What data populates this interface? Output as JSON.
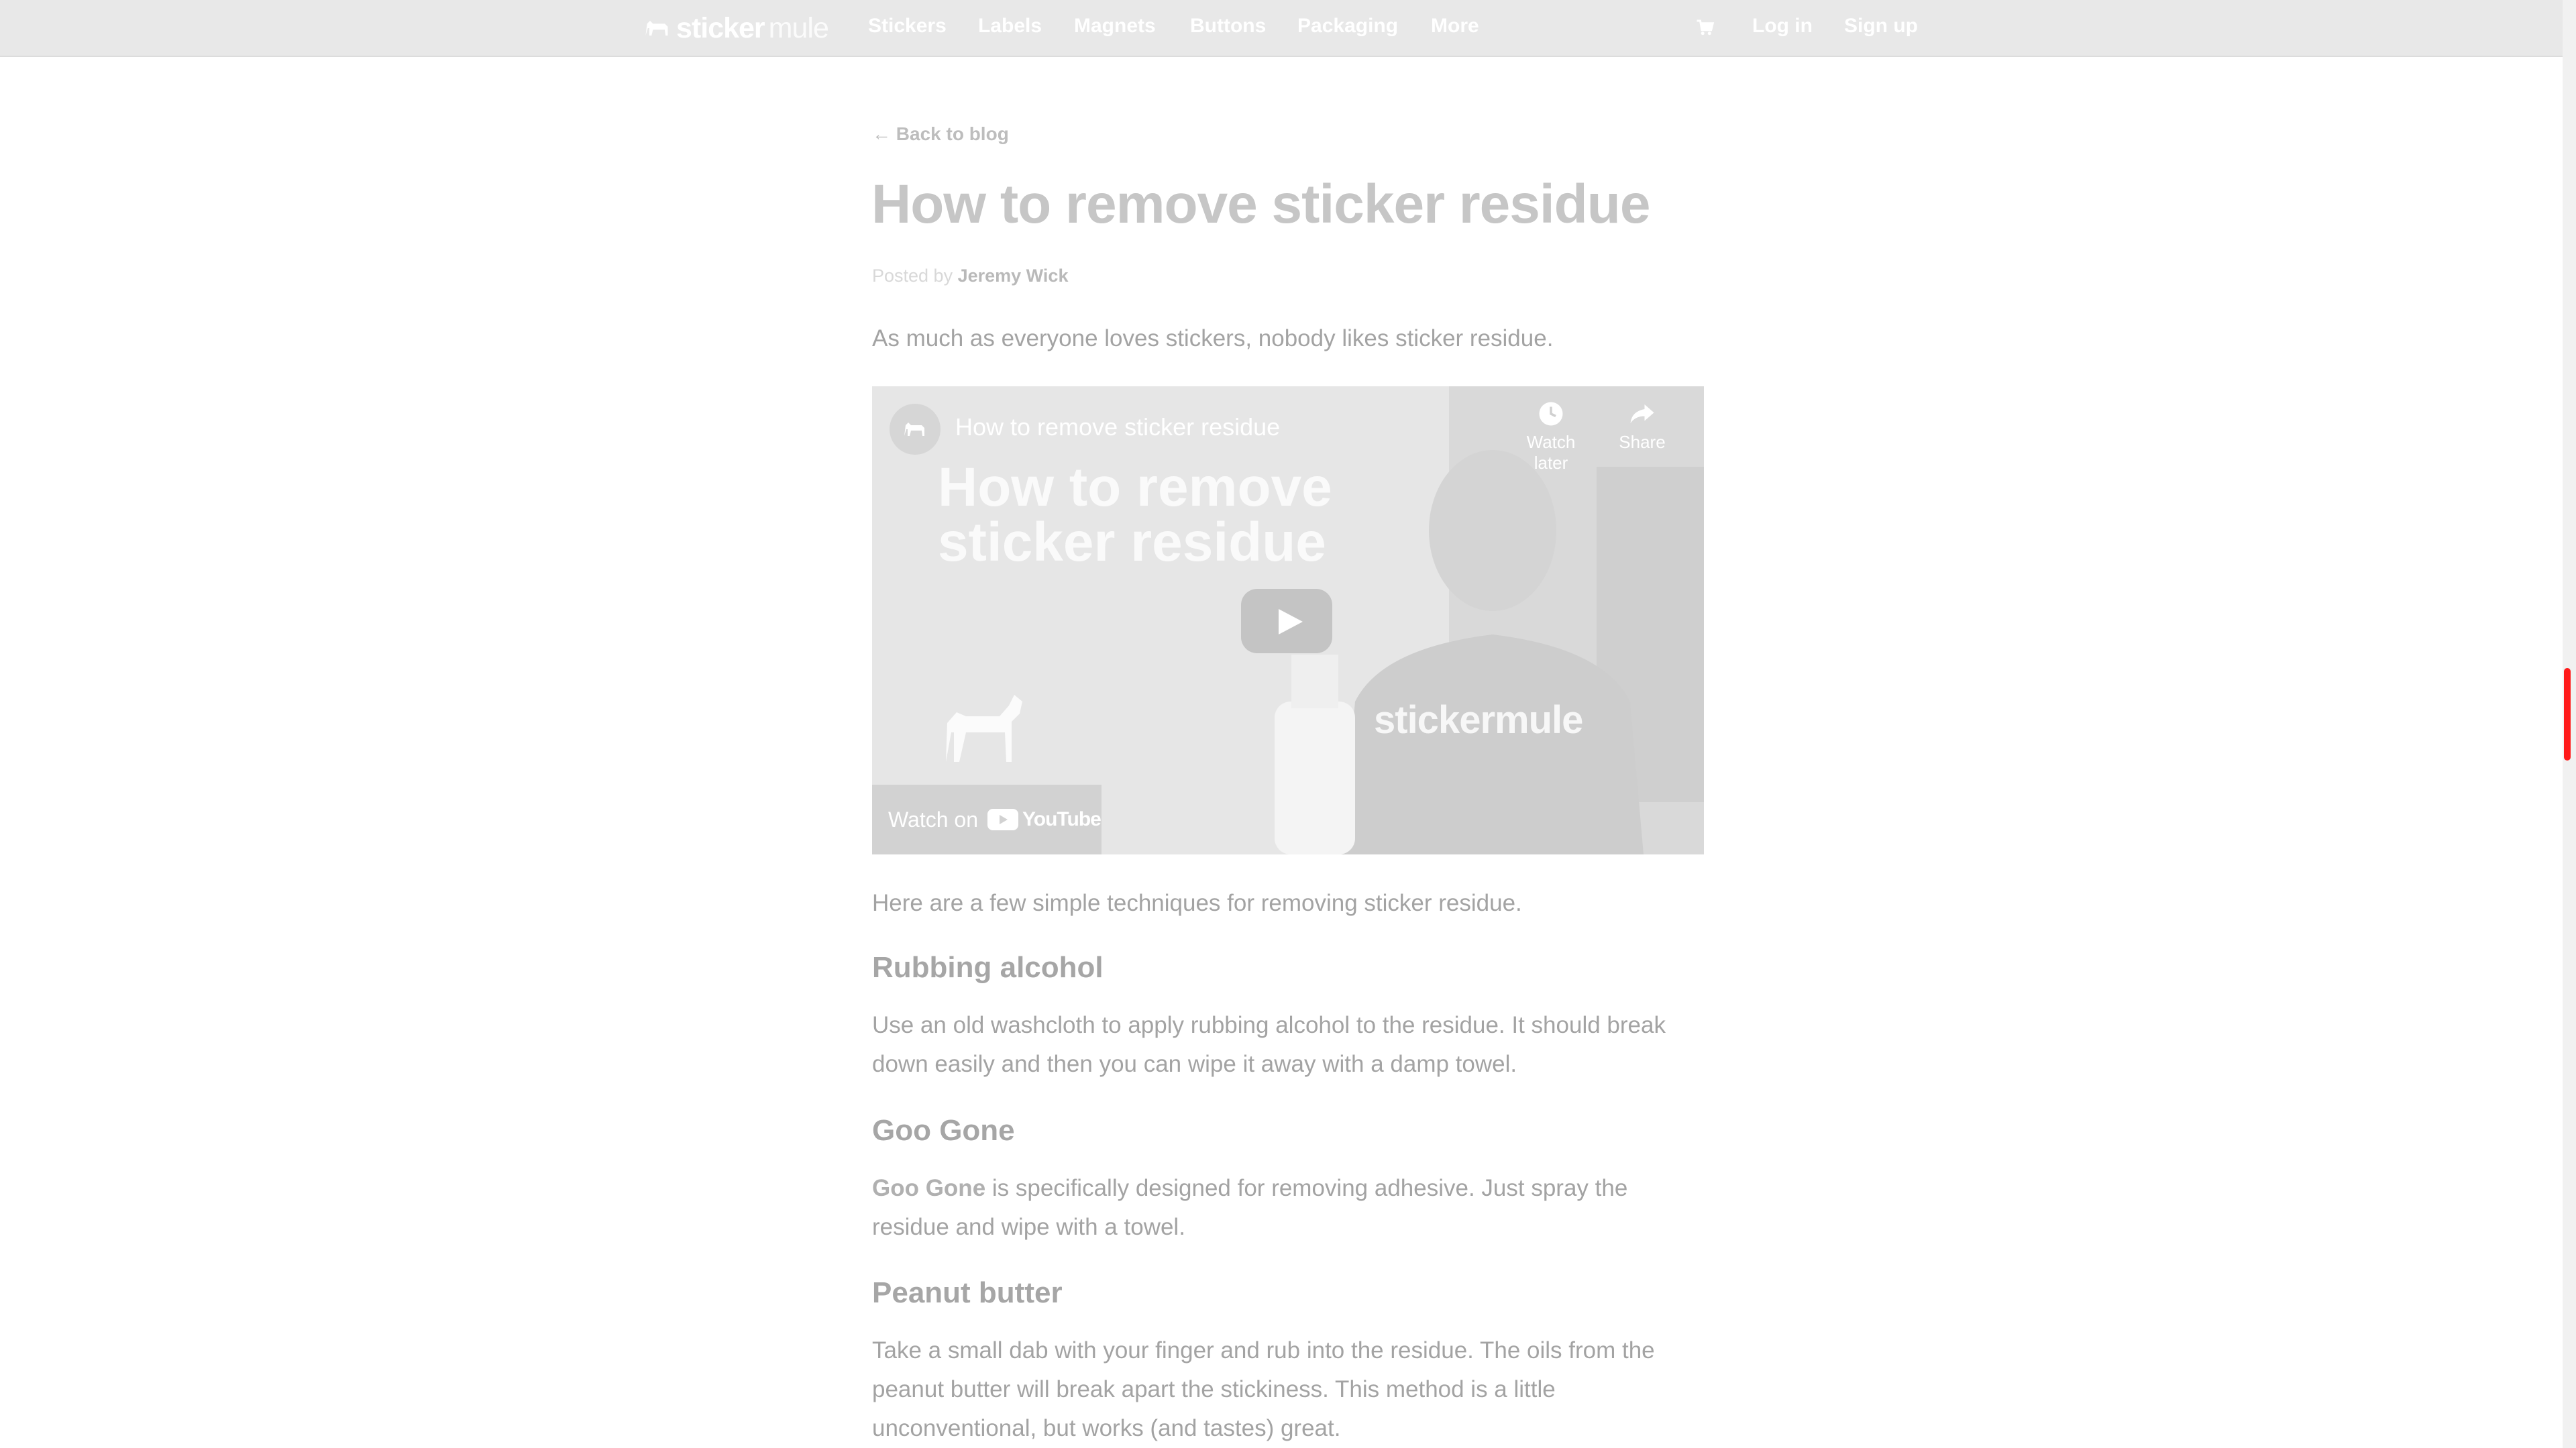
{
  "nav": {
    "logo_bold": "sticker",
    "logo_light": "mule",
    "items": [
      "Stickers",
      "Labels",
      "Magnets",
      "Buttons",
      "Packaging",
      "More"
    ],
    "login": "Log in",
    "signup": "Sign up",
    "cart_icon": "cart-icon"
  },
  "article": {
    "back_link": "← Back to blog",
    "title": "How to remove sticker residue",
    "byline_prefix": "Posted by",
    "author": "Jeremy Wick",
    "intro": "As much as everyone loves stickers, nobody likes sticker residue.",
    "after_video": "Here are a few simple techniques for removing sticker residue.",
    "sections": [
      {
        "heading": "Rubbing alcohol",
        "body": "Use an old washcloth to apply rubbing alcohol to the residue. It should break down easily and then you can wipe it away with a damp towel."
      },
      {
        "heading": "Goo Gone",
        "link": "Goo Gone",
        "body": " is specifically designed for removing adhesive. Just spray the residue and wipe with a towel."
      },
      {
        "heading": "Peanut butter",
        "body": "Take a small dab with your finger and rub into the residue. The oils from the peanut butter will break apart the stickiness. This method is a little unconventional, but works (and tastes) great."
      }
    ]
  },
  "video": {
    "title": "How to remove sticker residue",
    "thumbnail_headline": "How to remove sticker residue",
    "thumbnail_brand": "stickermule",
    "watch_later": "Watch later",
    "share": "Share",
    "watch_on": "Watch on",
    "youtube": "YouTube"
  },
  "colors": {
    "nav_bg": "#e8e8e8",
    "scroll_thumb": "#ff1a1a"
  }
}
